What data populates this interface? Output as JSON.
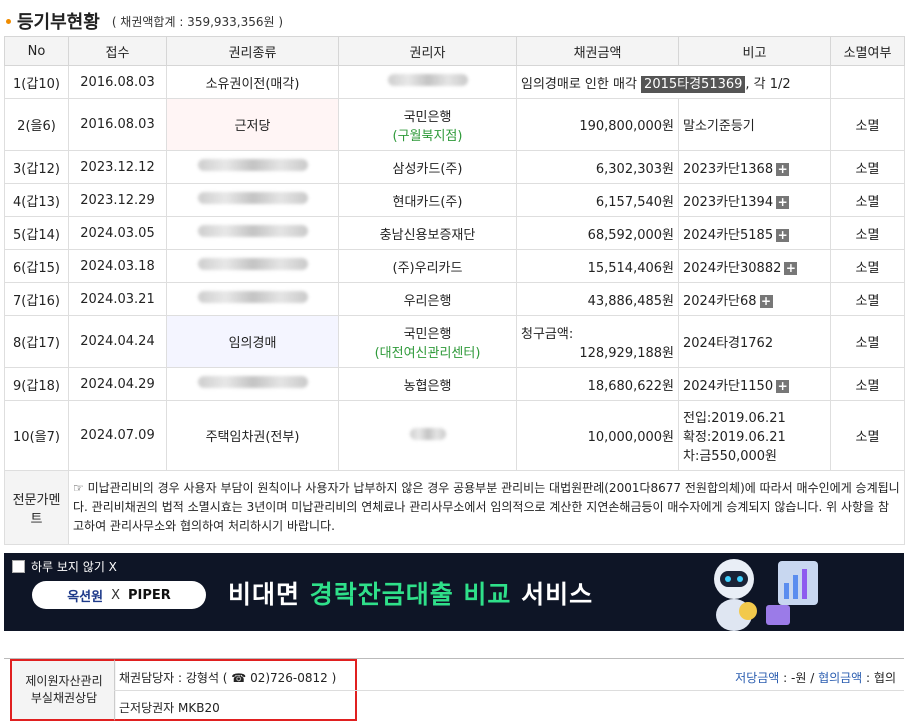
{
  "header": {
    "title": "등기부현황",
    "sum": "( 채권액합계 : 359,933,356원 )"
  },
  "columns": [
    "No",
    "접수",
    "권리종류",
    "권리자",
    "채권금액",
    "비고",
    "소멸여부"
  ],
  "rows": [
    {
      "no": "1(갑10)",
      "date": "2016.08.03",
      "type": "소유권이전(매각)",
      "holder": "",
      "holder_sub": "",
      "amount": "",
      "note_pre": "임의경매로 인한 매각 ",
      "note_case": "2015타경51369",
      "note_post": ", 각 1/2",
      "plus": false,
      "status": "",
      "blur": true,
      "type_bg": ""
    },
    {
      "no": "2(을6)",
      "date": "2016.08.03",
      "type": "근저당",
      "holder": "국민은행",
      "holder_sub": "(구월북지점)",
      "amount": "190,800,000원",
      "note_pre": "말소기준등기",
      "note_case": "",
      "note_post": "",
      "plus": false,
      "status": "소멸",
      "blur": false,
      "type_bg": "pink"
    },
    {
      "no": "3(갑12)",
      "date": "2023.12.12",
      "type": "",
      "holder": "삼성카드(주)",
      "holder_sub": "",
      "amount": "6,302,303원",
      "note_pre": "2023카단1368",
      "note_case": "",
      "note_post": "",
      "plus": true,
      "status": "소멸",
      "blur": false,
      "type_bg": "blurtype"
    },
    {
      "no": "4(갑13)",
      "date": "2023.12.29",
      "type": "",
      "holder": "현대카드(주)",
      "holder_sub": "",
      "amount": "6,157,540원",
      "note_pre": "2023카단1394",
      "note_case": "",
      "note_post": "",
      "plus": true,
      "status": "소멸",
      "blur": false,
      "type_bg": "blurtype"
    },
    {
      "no": "5(갑14)",
      "date": "2024.03.05",
      "type": "",
      "holder": "충남신용보증재단",
      "holder_sub": "",
      "amount": "68,592,000원",
      "note_pre": "2024카단5185",
      "note_case": "",
      "note_post": "",
      "plus": true,
      "status": "소멸",
      "blur": false,
      "type_bg": "blurtype"
    },
    {
      "no": "6(갑15)",
      "date": "2024.03.18",
      "type": "",
      "holder": "(주)우리카드",
      "holder_sub": "",
      "amount": "15,514,406원",
      "note_pre": "2024카단30882",
      "note_case": "",
      "note_post": "",
      "plus": true,
      "status": "소멸",
      "blur": false,
      "type_bg": "blurtype"
    },
    {
      "no": "7(갑16)",
      "date": "2024.03.21",
      "type": "",
      "holder": "우리은행",
      "holder_sub": "",
      "amount": "43,886,485원",
      "note_pre": "2024카단68",
      "note_case": "",
      "note_post": "",
      "plus": true,
      "status": "소멸",
      "blur": false,
      "type_bg": "blurtype"
    },
    {
      "no": "8(갑17)",
      "date": "2024.04.24",
      "type": "임의경매",
      "holder": "국민은행",
      "holder_sub": "(대전여신관리센터)",
      "amount_label": "청구금액:",
      "amount": "128,929,188원",
      "note_pre": "2024타경1762",
      "note_case": "",
      "note_post": "",
      "plus": false,
      "status": "소멸",
      "blur": false,
      "type_bg": "lavender"
    },
    {
      "no": "9(갑18)",
      "date": "2024.04.29",
      "type": "",
      "holder": "농협은행",
      "holder_sub": "",
      "amount": "18,680,622원",
      "note_pre": "2024카단1150",
      "note_case": "",
      "note_post": "",
      "plus": true,
      "status": "소멸",
      "blur": false,
      "type_bg": "blurtype"
    },
    {
      "no": "10(을7)",
      "date": "2024.07.09",
      "type": "주택임차권(전부)",
      "holder": "",
      "holder_sub": "",
      "amount": "10,000,000원",
      "note_lines": [
        "전입:2019.06.21",
        "확정:2019.06.21",
        "차:금550,000원"
      ],
      "plus": false,
      "status": "소멸",
      "blur": true,
      "type_bg": ""
    }
  ],
  "comment": {
    "label": "전문가멘트",
    "text": "☞ 미납관리비의 경우 사용자 부담이 원칙이나 사용자가 납부하지 않은 경우 공용부분 관리비는 대법원판례(2001다8677 전원합의체)에 따라서 매수인에게 승계됩니다. 관리비채권의 법적 소멸시효는 3년이며 미납관리비의 연체료나 관리사무소에서 임의적으로 계산한 지연손해금등이 매수자에게 승계되지 않습니다. 위 사항을 참고하여 관리사무소와 협의하여 처리하시기 바랍니다."
  },
  "banner": {
    "no_show": "하루 보지 않기 X",
    "brand1": "옥션원",
    "x": "X",
    "brand2": "PIPER",
    "slogan_pre": "비대면 ",
    "slogan_hl": "경락잔금대출 비교",
    "slogan_post": " 서비스"
  },
  "contact": {
    "label": "제이원자산관리\n부실채권상담",
    "manager": "채권담당자 : 강형석 ( ☎ 02)726-0812 )",
    "holder": "근저당권자 MKB20",
    "price_label": "저당금액",
    "price_value": " : -원 / ",
    "nego_label": "협의금액",
    "nego_value": " : 협의"
  },
  "colors": {
    "accent": "#f08c00",
    "green": "#2f9a3a",
    "banner_bg": "#0e1526",
    "highlight_border": "#e02020"
  }
}
